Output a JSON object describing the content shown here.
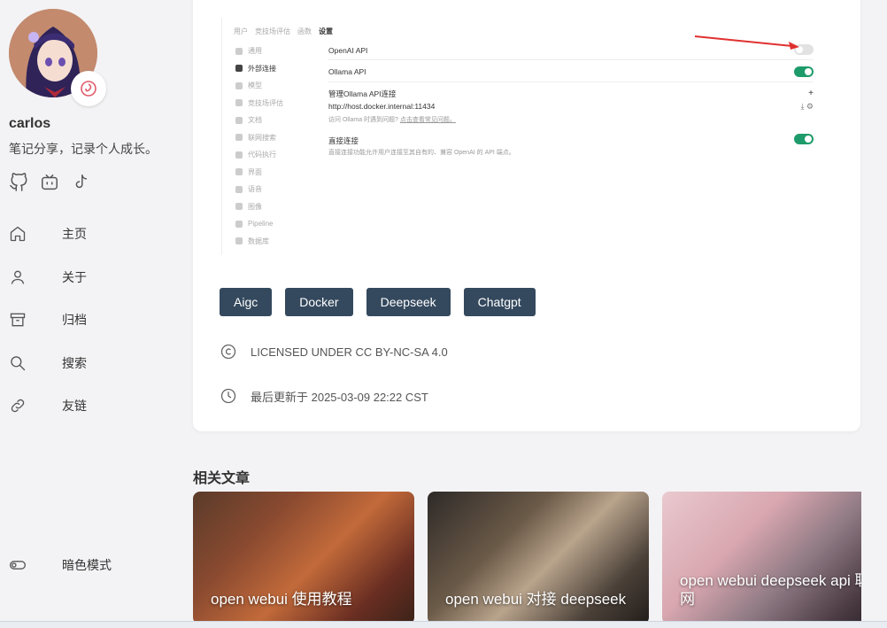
{
  "sidebar": {
    "author": "carlos",
    "bio": "笔记分享，记录个人成长。",
    "socials": [
      "github-icon",
      "bilibili-icon",
      "tiktok-icon"
    ],
    "nav": [
      {
        "label": "主页",
        "icon": "home-icon"
      },
      {
        "label": "关于",
        "icon": "user-icon"
      },
      {
        "label": "归档",
        "icon": "archive-icon"
      },
      {
        "label": "搜索",
        "icon": "search-icon"
      },
      {
        "label": "友链",
        "icon": "link-icon"
      }
    ],
    "dark_mode": "暗色模式"
  },
  "screenshot": {
    "tabs": [
      "用户",
      "竞技场评估",
      "函数",
      "设置"
    ],
    "menu": [
      "通用",
      "外部连接",
      "模型",
      "竞技场评估",
      "文档",
      "联网搜索",
      "代码执行",
      "界面",
      "语音",
      "图像",
      "Pipeline",
      "数据库"
    ],
    "openai_label": "OpenAI API",
    "openai_enabled": false,
    "ollama_label": "Ollama API",
    "ollama_enabled": true,
    "manage_label": "管理Ollama API连接",
    "plus": "+",
    "ollama_url": "http://host.docker.internal:11434",
    "ollama_hint": "访问 Ollama 时遇到问题?",
    "ollama_hint_link": "点击查看常见问题。",
    "direct_label": "直接连接",
    "direct_enabled": true,
    "direct_desc": "直接连接功能允许用户连接至其自有的、兼容 OpenAI 的 API 端点。"
  },
  "tags": [
    "Aigc",
    "Docker",
    "Deepseek",
    "Chatgpt"
  ],
  "license": "LICENSED UNDER CC BY-NC-SA 4.0",
  "updated": "最后更新于 2025-03-09 22:22 CST",
  "related": {
    "title": "相关文章",
    "posts": [
      {
        "title": "open webui 使用教程"
      },
      {
        "title": "open webui 对接 deepseek"
      },
      {
        "title": "open webui deepseek api 联网"
      }
    ]
  },
  "colors": {
    "tag_bg": "#34495e",
    "toggle_on": "#1e9b6a",
    "arrow": "#e03030"
  }
}
